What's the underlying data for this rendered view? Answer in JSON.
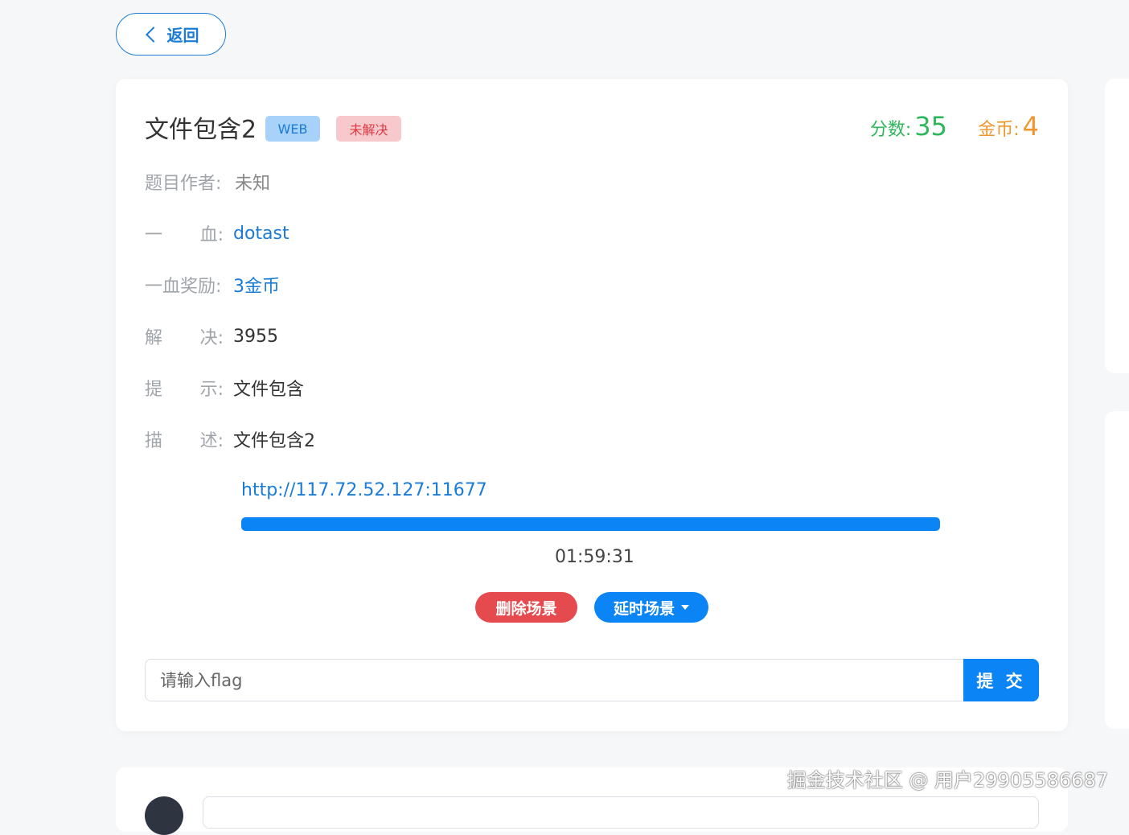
{
  "back": {
    "label": "返回"
  },
  "challenge": {
    "title": "文件包含2",
    "category": "WEB",
    "status": "未解决",
    "score_label": "分数:",
    "score": "35",
    "coin_label": "金币:",
    "coin": "4"
  },
  "info": {
    "author_label": "题目作者:",
    "author": "未知",
    "blood_label_a": "一",
    "blood_label_b": "血:",
    "blood": "dotast",
    "reward_label": "一血奖励:",
    "reward": "3金币",
    "solved_label_a": "解",
    "solved_label_b": "决:",
    "solved": "3955",
    "hint_label_a": "提",
    "hint_label_b": "示:",
    "hint": "文件包含",
    "desc_label_a": "描",
    "desc_label_b": "述:",
    "desc": "文件包含2"
  },
  "scene": {
    "url": "http://117.72.52.127:11677",
    "progress": 1.0,
    "timer": "01:59:31",
    "delete_label": "删除场景",
    "delay_label": "延时场景"
  },
  "flag": {
    "placeholder": "请输入flag",
    "submit_label": "提 交"
  },
  "watermark": "掘金技术社区 @ 用户29905586687",
  "colors": {
    "primary": "#0b84f5",
    "danger": "#e54a4e",
    "score": "#2eb75a",
    "coin": "#f0962e"
  }
}
